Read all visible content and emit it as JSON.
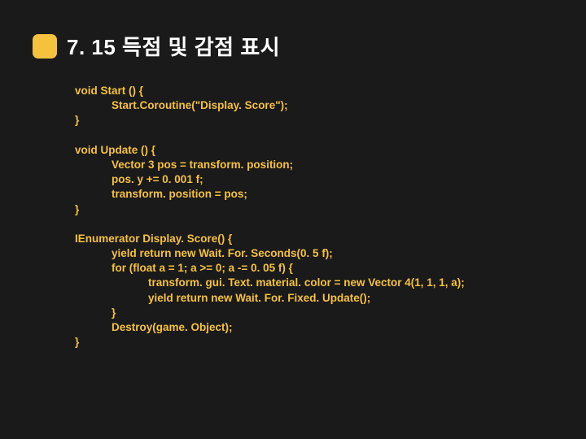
{
  "title": "7. 15 득점 및 감점 표시",
  "blocks": [
    {
      "lines": [
        "void Start () {",
        "            Start.Coroutine(\"Display. Score\");",
        "}"
      ]
    },
    {
      "lines": [
        "void Update () {",
        "            Vector 3 pos = transform. position;",
        "            pos. y += 0. 001 f;",
        "            transform. position = pos;",
        "}"
      ]
    },
    {
      "lines": [
        "IEnumerator Display. Score() {",
        "            yield return new Wait. For. Seconds(0. 5 f);",
        "",
        "            for (float a = 1; a >= 0; a -= 0. 05 f) {",
        "                        transform. gui. Text. material. color = new Vector 4(1, 1, 1, a);",
        "                        yield return new Wait. For. Fixed. Update();",
        "            }",
        "",
        "            Destroy(game. Object);",
        "}"
      ]
    }
  ]
}
